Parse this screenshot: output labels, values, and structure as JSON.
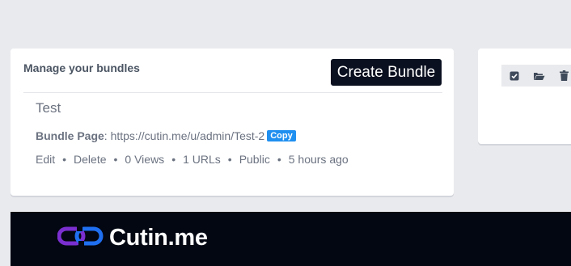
{
  "bundles_card": {
    "title": "Manage your bundles",
    "create_label": "Create Bundle",
    "bundle": {
      "name": "Test",
      "page_label": "Bundle Page",
      "page_url": ": https://cutin.me/u/admin/Test-2",
      "copy_label": "Copy",
      "edit_label": "Edit",
      "delete_label": "Delete",
      "views": "0 Views",
      "urls": "1 URLs",
      "visibility": "Public",
      "time": "5 hours ago",
      "separator": "•"
    }
  },
  "side_toolbar": {
    "icons": [
      "check-square-icon",
      "folder-open-icon",
      "trash-icon"
    ]
  },
  "footer": {
    "brand": "Cutin.me",
    "logo_icon": "chain-link-icon",
    "colors": {
      "logo_purple": "#7b2fd0",
      "logo_blue": "#1f6ff0"
    }
  }
}
